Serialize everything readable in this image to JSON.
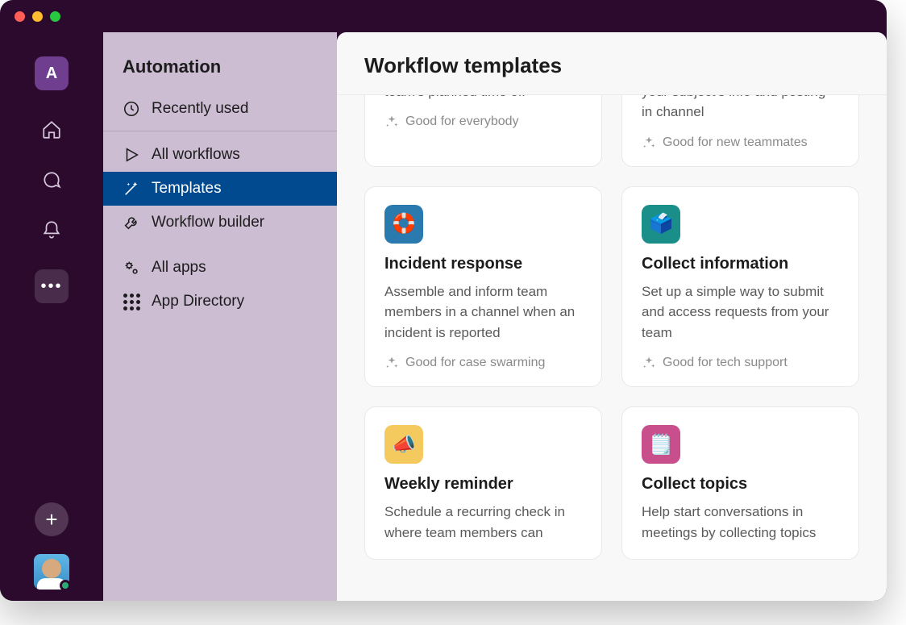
{
  "workspace_initial": "A",
  "sidebar": {
    "title": "Automation",
    "items": [
      {
        "label": "Recently used",
        "icon": "clock"
      },
      {
        "label": "All workflows",
        "icon": "play"
      },
      {
        "label": "Templates",
        "icon": "wand",
        "selected": true
      },
      {
        "label": "Workflow builder",
        "icon": "wrench"
      },
      {
        "label": "All apps",
        "icon": "gears"
      },
      {
        "label": "App Directory",
        "icon": "grid"
      }
    ]
  },
  "content": {
    "title": "Workflow templates",
    "cards": [
      {
        "desc": "Request and manage your team's planned time off",
        "tag": "Good for everybody",
        "partial_top": true
      },
      {
        "desc": "Kick off an AMA by collecting your subject's info and posting in channel",
        "tag": "Good for new teammates",
        "partial_top": true
      },
      {
        "title": "Incident response",
        "desc": "Assemble and inform team members in a channel when an incident is reported",
        "tag": "Good for case swarming",
        "icon_color": "ic-blue",
        "emoji": "🛟"
      },
      {
        "title": "Collect information",
        "desc": "Set up a simple way to submit and access requests from your team",
        "tag": "Good for tech support",
        "icon_color": "ic-teal",
        "emoji": "🗳️"
      },
      {
        "title": "Weekly reminder",
        "desc": "Schedule a recurring check in where team members can",
        "icon_color": "ic-yellow",
        "emoji": "📣",
        "partial_bottom": true
      },
      {
        "title": "Collect topics",
        "desc": "Help start conversations in meetings by collecting topics",
        "icon_color": "ic-magenta",
        "emoji": "🗒️",
        "partial_bottom": true
      }
    ]
  }
}
